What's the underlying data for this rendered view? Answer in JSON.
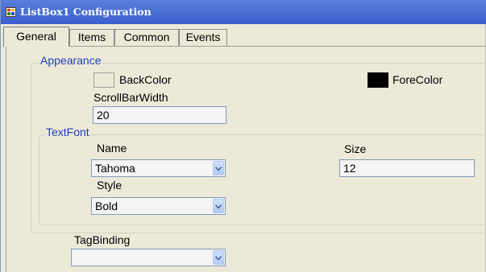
{
  "window": {
    "title": "ListBox1 Configuration",
    "icon": "app-grid-icon"
  },
  "tabs": [
    {
      "label": "General",
      "active": true
    },
    {
      "label": "Items",
      "active": false
    },
    {
      "label": "Common",
      "active": false
    },
    {
      "label": "Events",
      "active": false
    }
  ],
  "appearance": {
    "group_label": "Appearance",
    "backcolor_label": "BackColor",
    "backcolor": "#ece9d8",
    "forecolor_label": "ForeColor",
    "forecolor": "#000000",
    "scrollbar_width_label": "ScrollBarWidth",
    "scrollbar_width_value": "20"
  },
  "textfont": {
    "group_label": "TextFont",
    "name_label": "Name",
    "name_value": "Tahoma",
    "size_label": "Size",
    "size_value": "12",
    "style_label": "Style",
    "style_value": "Bold"
  },
  "tagbinding": {
    "label": "TagBinding",
    "value": ""
  },
  "colors": {
    "accent": "#1f3fbf",
    "titlebar": "#3a5fcd",
    "window_bg": "#ece9d8"
  }
}
